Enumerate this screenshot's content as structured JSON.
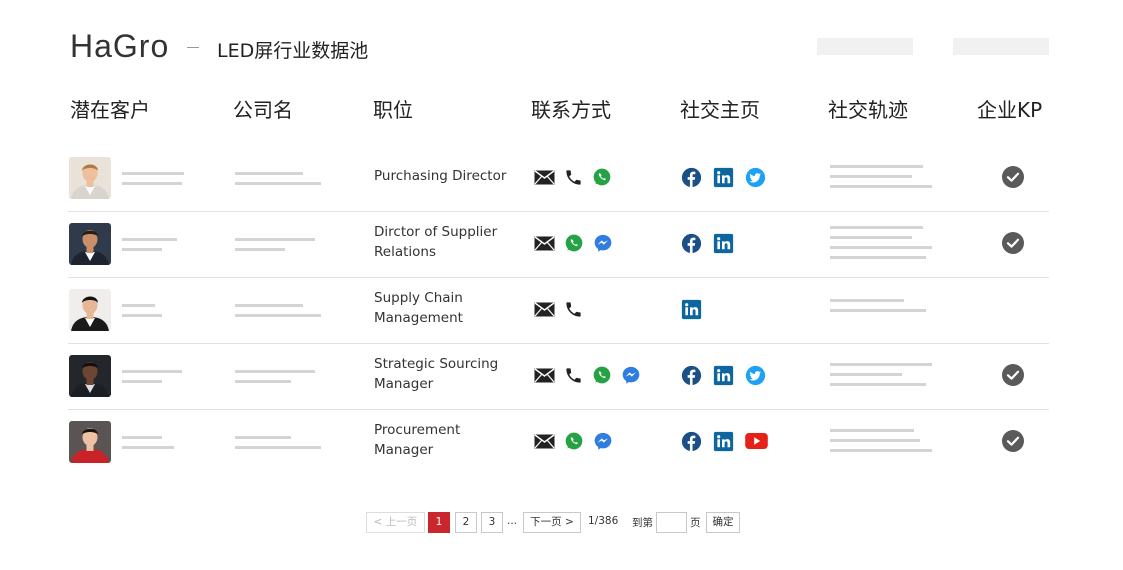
{
  "header": {
    "logo": "HaGro",
    "subtitle": "LED屏行业数据池"
  },
  "columns": [
    "潜在客户",
    "公司名",
    "职位",
    "联系方式",
    "社交主页",
    "社交轨迹",
    "企业KP"
  ],
  "rows": [
    {
      "title_lines": [
        "Purchasing Director"
      ],
      "contacts": [
        "mail-icon",
        "phone-icon",
        "whatsapp-icon"
      ],
      "socials": [
        "facebook-icon",
        "linkedin-icon",
        "twitter-icon"
      ],
      "kp": true
    },
    {
      "title_lines": [
        "Dirctor of Supplier",
        "Relations"
      ],
      "contacts": [
        "mail-icon",
        "whatsapp-icon",
        "messenger-icon"
      ],
      "socials": [
        "facebook-icon",
        "linkedin-icon"
      ],
      "kp": true
    },
    {
      "title_lines": [
        "Supply Chain",
        "Management"
      ],
      "contacts": [
        "mail-icon",
        "phone-icon"
      ],
      "socials": [
        "linkedin-icon"
      ],
      "kp": false
    },
    {
      "title_lines": [
        "Strategic Sourcing",
        "Manager"
      ],
      "contacts": [
        "mail-icon",
        "phone-icon",
        "whatsapp-icon",
        "messenger-icon"
      ],
      "socials": [
        "facebook-icon",
        "linkedin-icon",
        "twitter-icon"
      ],
      "kp": true
    },
    {
      "title_lines": [
        "Procurement",
        "Manager"
      ],
      "contacts": [
        "mail-icon",
        "whatsapp-icon",
        "messenger-icon"
      ],
      "socials": [
        "facebook-icon",
        "linkedin-icon",
        "youtube-icon"
      ],
      "kp": true
    }
  ],
  "pagination": {
    "prev": "< 上一页",
    "pages": [
      "1",
      "2",
      "3"
    ],
    "current": "1",
    "ellipsis": "...",
    "next": "下一页 >",
    "total": "1/386",
    "goto": "到第",
    "page_unit": "页",
    "confirm": "确定"
  },
  "colors": {
    "accent": "#c9272d",
    "facebook": "#1b4f86",
    "linkedin": "#0d66a0",
    "twitter": "#1da1f2",
    "whatsapp": "#25a244",
    "messenger": "#2f7de1",
    "youtube": "#e62117",
    "check": "#5a5a5a"
  }
}
